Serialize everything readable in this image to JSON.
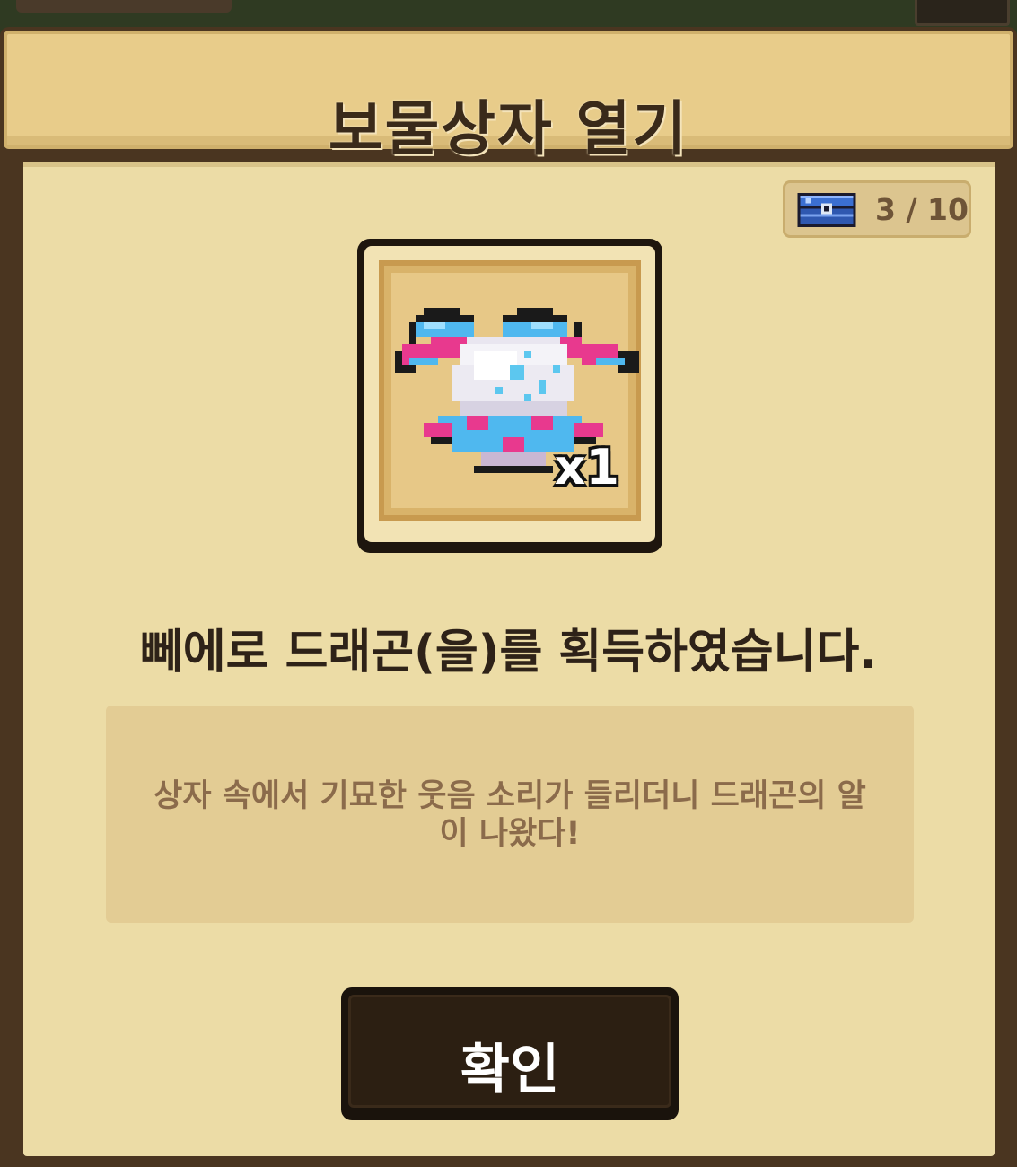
{
  "dialog": {
    "title": "보물상자 열기",
    "counter": {
      "icon": "treasure-chest-icon",
      "text": "3 / 10"
    },
    "item": {
      "icon": "dragon-egg-armor-icon",
      "quantity": "x1"
    },
    "acquired_message": "뻬에로 드래곤(을)를 획득하였습니다.",
    "description": "상자 속에서 기묘한 웃음 소리가 들리더니 드래곤의 알이 나왔다!",
    "confirm_label": "확인"
  },
  "colors": {
    "panel": "#ecdca6",
    "header": "#e8cc8a",
    "button": "#2c1f12",
    "text_dark": "#2e2218",
    "text_muted": "#8b6b4b"
  }
}
